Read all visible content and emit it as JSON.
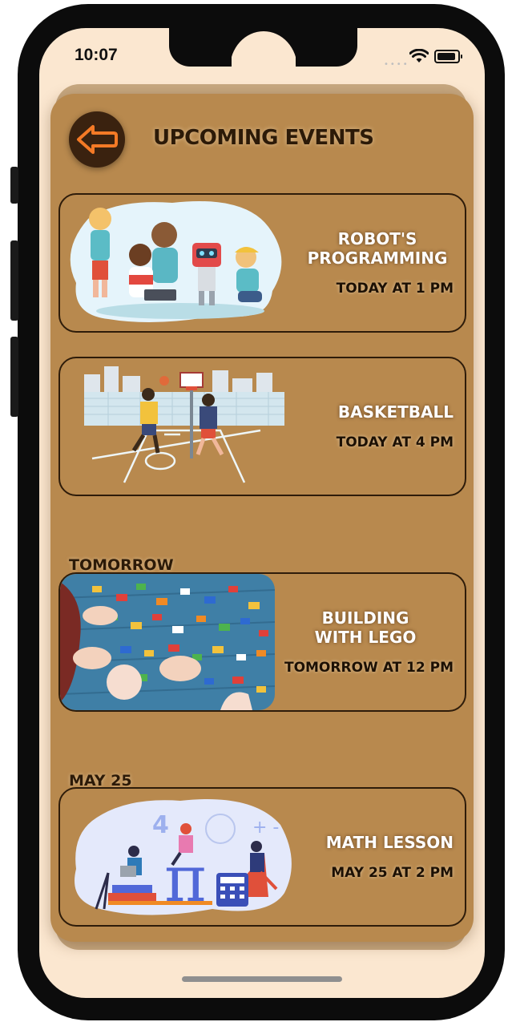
{
  "status_bar": {
    "time": "10:07"
  },
  "header": {
    "title": "UPCOMING EVENTS",
    "back_icon": "arrow-left-icon"
  },
  "colors": {
    "panel": "#b8894e",
    "screen": "#fbe7d0",
    "back_button": "#3a220f",
    "arrow": "#f47a26"
  },
  "sections": [
    {
      "label": "",
      "events": [
        {
          "title": "ROBOT'S PROGRAMMING",
          "time": "TODAY AT 1 PM",
          "image": "kids-robot-illustration"
        },
        {
          "title": "BASKETBALL",
          "time": "TODAY AT 4 PM",
          "image": "basketball-court-illustration"
        }
      ]
    },
    {
      "label": "TOMORROW",
      "events": [
        {
          "title": "BUILDING WITH LEGO",
          "time": "TOMORROW AT 12 PM",
          "image": "lego-bricks-photo"
        }
      ]
    },
    {
      "label": "MAY 25",
      "events": [
        {
          "title": "MATH LESSON",
          "time": "MAY 25 AT 2 PM",
          "image": "math-lesson-illustration"
        }
      ]
    }
  ]
}
